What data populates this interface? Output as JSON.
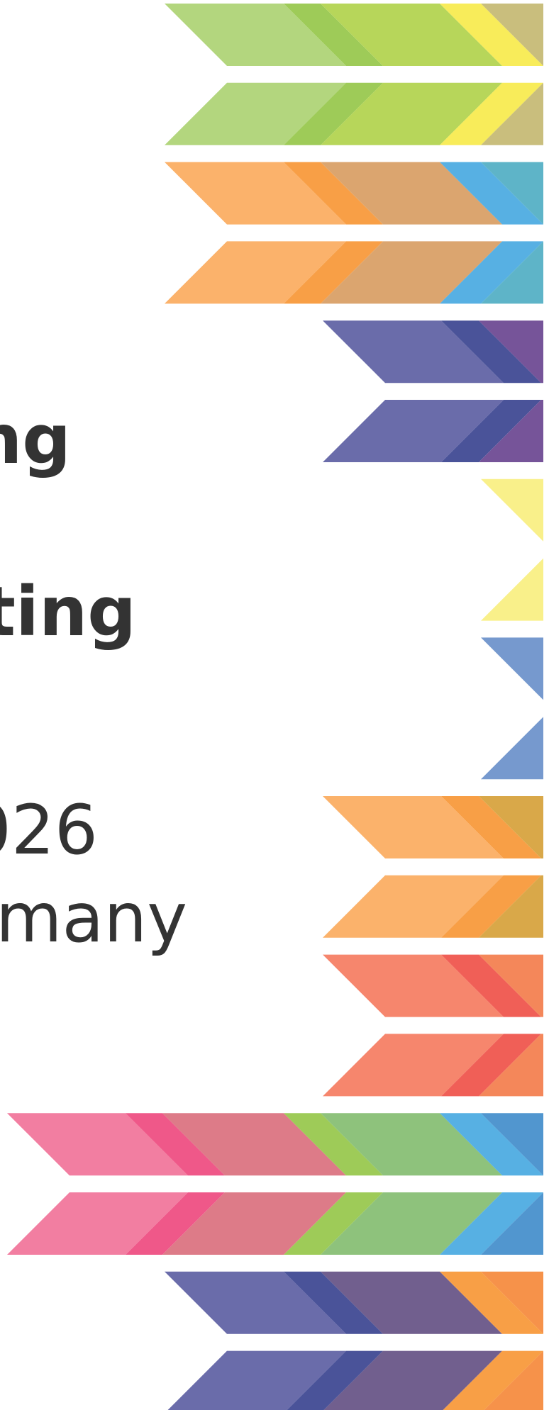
{
  "text_lines": [
    "ng",
    "nting",
    "026",
    "rmany"
  ],
  "palette": {
    "green_light": "#b3d67e",
    "green_mid": "#9ecb58",
    "lime": "#b7d65a",
    "yellow": "#f8ec5a",
    "khaki": "#c9be7d",
    "orange_light": "#fbb26b",
    "orange": "#f89f46",
    "tan": "#dba56f",
    "sky": "#57b0e3",
    "teal": "#5eb4c8",
    "indigo_light": "#6a6caa",
    "indigo": "#4a5399",
    "purple": "#765499",
    "yellow_pale": "#f9f08a",
    "blue_mid": "#7699ce",
    "gold": "#d9a849",
    "salmon": "#f6866d",
    "red": "#f05f57",
    "coral": "#f4875a",
    "pink": "#f27ea1",
    "magenta": "#ef5889",
    "rose": "#dd7b88",
    "green_soft": "#8ec27c",
    "steel_blue": "#5196cf",
    "plum": "#715f8e",
    "orange_deep": "#f6924a"
  },
  "stripes": [
    {
      "dir": "down",
      "segments": [
        {
          "from": 232,
          "to": 400,
          "color": "green_light"
        },
        {
          "from": 400,
          "to": 452,
          "color": "green_mid"
        },
        {
          "from": 452,
          "to": 620,
          "color": "lime"
        },
        {
          "from": 620,
          "to": 678,
          "color": "yellow"
        },
        {
          "from": 678,
          "to": 774,
          "color": "khaki"
        }
      ]
    },
    {
      "dir": "up",
      "segments": [
        {
          "from": 232,
          "to": 400,
          "color": "green_light"
        },
        {
          "from": 400,
          "to": 452,
          "color": "green_mid"
        },
        {
          "from": 452,
          "to": 620,
          "color": "lime"
        },
        {
          "from": 620,
          "to": 678,
          "color": "yellow"
        },
        {
          "from": 678,
          "to": 774,
          "color": "khaki"
        }
      ]
    },
    {
      "dir": "down",
      "segments": [
        {
          "from": 232,
          "to": 400,
          "color": "orange_light"
        },
        {
          "from": 400,
          "to": 452,
          "color": "orange"
        },
        {
          "from": 452,
          "to": 620,
          "color": "tan"
        },
        {
          "from": 620,
          "to": 678,
          "color": "sky"
        },
        {
          "from": 678,
          "to": 774,
          "color": "teal"
        }
      ]
    },
    {
      "dir": "up",
      "segments": [
        {
          "from": 232,
          "to": 400,
          "color": "orange_light"
        },
        {
          "from": 400,
          "to": 452,
          "color": "orange"
        },
        {
          "from": 452,
          "to": 620,
          "color": "tan"
        },
        {
          "from": 620,
          "to": 678,
          "color": "sky"
        },
        {
          "from": 678,
          "to": 774,
          "color": "teal"
        }
      ]
    },
    {
      "dir": "down",
      "segments": [
        {
          "from": 455,
          "to": 622,
          "color": "indigo_light"
        },
        {
          "from": 622,
          "to": 675,
          "color": "indigo"
        },
        {
          "from": 675,
          "to": 774,
          "color": "purple"
        }
      ]
    },
    {
      "dir": "up",
      "segments": [
        {
          "from": 455,
          "to": 622,
          "color": "indigo_light"
        },
        {
          "from": 622,
          "to": 675,
          "color": "indigo"
        },
        {
          "from": 675,
          "to": 774,
          "color": "purple"
        }
      ]
    },
    {
      "dir": "down",
      "segments": [
        {
          "from": 678,
          "to": 774,
          "color": "yellow_pale"
        }
      ]
    },
    {
      "dir": "up",
      "segments": [
        {
          "from": 678,
          "to": 774,
          "color": "yellow_pale"
        }
      ]
    },
    {
      "dir": "down",
      "segments": [
        {
          "from": 678,
          "to": 774,
          "color": "blue_mid"
        }
      ]
    },
    {
      "dir": "up",
      "segments": [
        {
          "from": 678,
          "to": 774,
          "color": "blue_mid"
        }
      ]
    },
    {
      "dir": "down",
      "segments": [
        {
          "from": 455,
          "to": 622,
          "color": "orange_light"
        },
        {
          "from": 622,
          "to": 675,
          "color": "orange"
        },
        {
          "from": 675,
          "to": 774,
          "color": "gold"
        }
      ]
    },
    {
      "dir": "up",
      "segments": [
        {
          "from": 455,
          "to": 622,
          "color": "orange_light"
        },
        {
          "from": 622,
          "to": 675,
          "color": "orange"
        },
        {
          "from": 675,
          "to": 774,
          "color": "gold"
        }
      ]
    },
    {
      "dir": "down",
      "segments": [
        {
          "from": 455,
          "to": 622,
          "color": "salmon"
        },
        {
          "from": 622,
          "to": 675,
          "color": "red"
        },
        {
          "from": 675,
          "to": 774,
          "color": "coral"
        }
      ]
    },
    {
      "dir": "up",
      "segments": [
        {
          "from": 455,
          "to": 622,
          "color": "salmon"
        },
        {
          "from": 622,
          "to": 675,
          "color": "red"
        },
        {
          "from": 675,
          "to": 774,
          "color": "coral"
        }
      ]
    },
    {
      "dir": "down",
      "segments": [
        {
          "from": 10,
          "to": 177,
          "color": "pink"
        },
        {
          "from": 177,
          "to": 229,
          "color": "magenta"
        },
        {
          "from": 229,
          "to": 400,
          "color": "rose"
        },
        {
          "from": 400,
          "to": 452,
          "color": "green_mid"
        },
        {
          "from": 452,
          "to": 620,
          "color": "green_soft"
        },
        {
          "from": 620,
          "to": 678,
          "color": "sky"
        },
        {
          "from": 678,
          "to": 774,
          "color": "steel_blue"
        }
      ]
    },
    {
      "dir": "up",
      "segments": [
        {
          "from": 10,
          "to": 177,
          "color": "pink"
        },
        {
          "from": 177,
          "to": 229,
          "color": "magenta"
        },
        {
          "from": 229,
          "to": 400,
          "color": "rose"
        },
        {
          "from": 400,
          "to": 452,
          "color": "green_mid"
        },
        {
          "from": 452,
          "to": 620,
          "color": "green_soft"
        },
        {
          "from": 620,
          "to": 678,
          "color": "sky"
        },
        {
          "from": 678,
          "to": 774,
          "color": "steel_blue"
        }
      ]
    },
    {
      "dir": "down",
      "segments": [
        {
          "from": 232,
          "to": 400,
          "color": "indigo_light"
        },
        {
          "from": 400,
          "to": 452,
          "color": "indigo"
        },
        {
          "from": 452,
          "to": 620,
          "color": "plum"
        },
        {
          "from": 620,
          "to": 678,
          "color": "orange"
        },
        {
          "from": 678,
          "to": 774,
          "color": "orange_deep"
        }
      ]
    },
    {
      "dir": "up",
      "segments": [
        {
          "from": 232,
          "to": 400,
          "color": "indigo_light"
        },
        {
          "from": 400,
          "to": 452,
          "color": "indigo"
        },
        {
          "from": 452,
          "to": 620,
          "color": "plum"
        },
        {
          "from": 620,
          "to": 678,
          "color": "orange"
        },
        {
          "from": 678,
          "to": 774,
          "color": "orange_deep"
        }
      ]
    }
  ]
}
